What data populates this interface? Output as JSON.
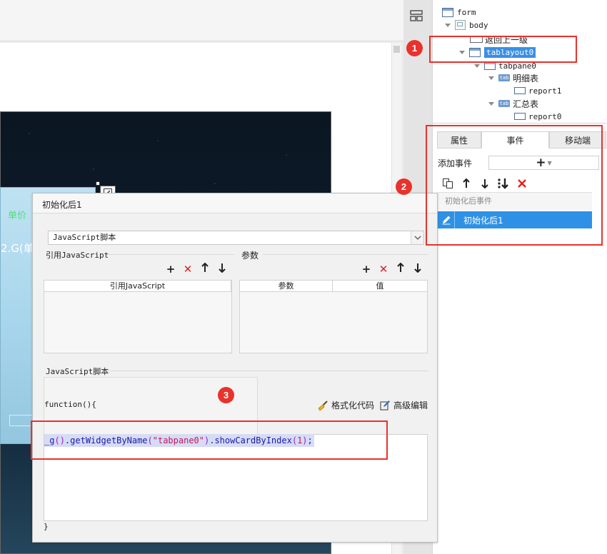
{
  "tree": {
    "nodes": {
      "form": "form",
      "body": "body",
      "back_label": "返回上一级",
      "tablayout": "tablayout0",
      "tabpane": "tabpane0",
      "tab_detail": "明细表",
      "report1": "report1",
      "tab_summary": "汇总表",
      "report0": "report0"
    },
    "tab_icon_text": "tab"
  },
  "events_panel": {
    "tabs": [
      "属性",
      "事件",
      "移动端"
    ],
    "active_tab": "事件",
    "add_event_label": "添加事件",
    "add_symbol": "+",
    "group_label": "初始化后事件",
    "selected_event": "初始化后1",
    "toolbar_icons": [
      "copy-icon",
      "arrow-up-icon",
      "arrow-down-icon",
      "move-bottom-icon",
      "delete-icon"
    ]
  },
  "dialog": {
    "title": "初始化后1",
    "script_type": "JavaScript脚本",
    "ref_js_label": "引用JavaScript",
    "params_label": "参数",
    "ref_js_column": "引用JavaScript",
    "param_columns": [
      "参数",
      "值"
    ],
    "js_section_label": "JavaScript脚本",
    "function_signature": "function(){",
    "format_label": "格式化代码",
    "advanced_label": "高级编辑",
    "code": {
      "cursor": "_",
      "p1": "g",
      "p2": "()",
      "p3": ".getWidgetByName",
      "p4": "(",
      "p5": "\"tabpane0\"",
      "p6": ")",
      "p7": ".showCardByIndex",
      "p8": "(",
      "p9": "1",
      "p10": ")",
      "p11": ";"
    },
    "closing_brace": "}"
  },
  "canvas": {
    "light_text_1": "单价",
    "light_text_2": "2.G(单"
  },
  "annotations": [
    "1",
    "2",
    "3"
  ],
  "colors": {
    "accent": "#2f91e6",
    "selection": "#3b8fe3",
    "annotation_red": "#e8322c",
    "delete_red": "#e02020"
  }
}
